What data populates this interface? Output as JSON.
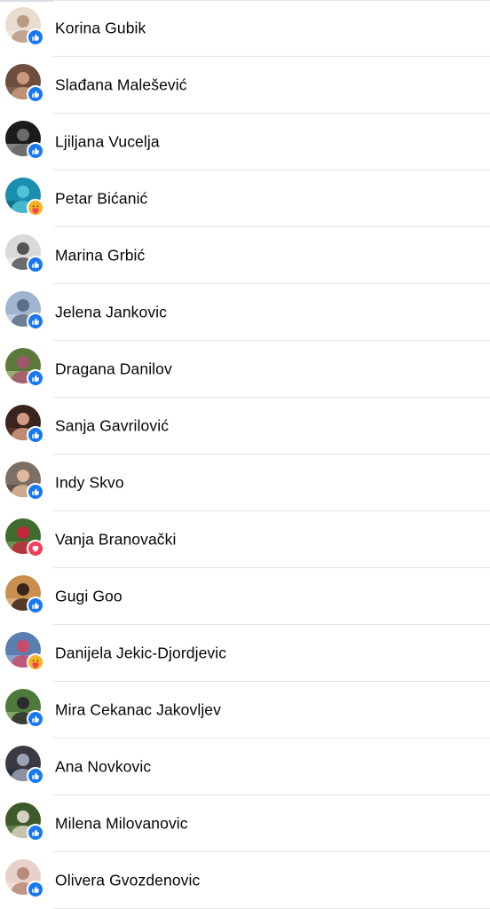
{
  "reactions_list": {
    "items": [
      {
        "name": "Korina Gubik",
        "reaction": "like-icon",
        "avatar_colors": [
          "#e8dccf",
          "#b89a83",
          "#f3ece5"
        ]
      },
      {
        "name": "Slađana Malešević",
        "reaction": "like-icon",
        "avatar_colors": [
          "#6f4e3d",
          "#c99a7c",
          "#8e7368"
        ]
      },
      {
        "name": "Ljiljana Vucelja",
        "reaction": "like-icon",
        "avatar_colors": [
          "#1b1b1b",
          "#6b6b6b",
          "#d8d8d8"
        ]
      },
      {
        "name": "Petar Bićanić",
        "reaction": "care-icon",
        "avatar_colors": [
          "#1a8fb0",
          "#4fc3d9",
          "#0d5e78"
        ]
      },
      {
        "name": "Marina Grbić",
        "reaction": "like-icon",
        "avatar_colors": [
          "#d9d9d9",
          "#555555",
          "#f4f4f4"
        ]
      },
      {
        "name": "Jelena Jankovic",
        "reaction": "like-icon",
        "avatar_colors": [
          "#9fb4cf",
          "#5d6e86",
          "#dbe5f1"
        ]
      },
      {
        "name": "Dragana Danilov",
        "reaction": "like-icon",
        "avatar_colors": [
          "#5b7a3a",
          "#a3556e",
          "#c8d9a0"
        ]
      },
      {
        "name": "Sanja Gavrilović",
        "reaction": "like-icon",
        "avatar_colors": [
          "#3a2420",
          "#d39a82",
          "#6a3c30"
        ]
      },
      {
        "name": "Indy Skvo",
        "reaction": "like-icon",
        "avatar_colors": [
          "#7b6f66",
          "#e0b89a",
          "#4a403a"
        ]
      },
      {
        "name": "Vanja Branovački",
        "reaction": "love-icon",
        "avatar_colors": [
          "#3f6b2e",
          "#c1263a",
          "#8fb36c"
        ]
      },
      {
        "name": "Gugi Goo",
        "reaction": "like-icon",
        "avatar_colors": [
          "#c88f4f",
          "#3a2518",
          "#e9c49a"
        ]
      },
      {
        "name": "Danijela Jekic-Djordjevic",
        "reaction": "care-icon",
        "avatar_colors": [
          "#5a7fb0",
          "#c64c6a",
          "#a9c2e0"
        ]
      },
      {
        "name": "Mira Cekanac Jakovljev",
        "reaction": "like-icon",
        "avatar_colors": [
          "#4e7a3a",
          "#2c2c2c",
          "#a9c98a"
        ]
      },
      {
        "name": "Ana Novkovic",
        "reaction": "like-icon",
        "avatar_colors": [
          "#3a3a44",
          "#9aa3b5",
          "#1e2a3a"
        ]
      },
      {
        "name": "Milena Milovanovic",
        "reaction": "like-icon",
        "avatar_colors": [
          "#3e5a2a",
          "#d8d0c4",
          "#7a9a5a"
        ]
      },
      {
        "name": "Olivera Gvozdenovic",
        "reaction": "like-icon",
        "avatar_colors": [
          "#e8d0c8",
          "#b88a7a",
          "#f5ebe6"
        ]
      }
    ]
  },
  "colors": {
    "like": "#1877f2",
    "love": "#f33e58",
    "care": "#f7b125",
    "divider": "#e4e6eb",
    "text": "#050505"
  }
}
